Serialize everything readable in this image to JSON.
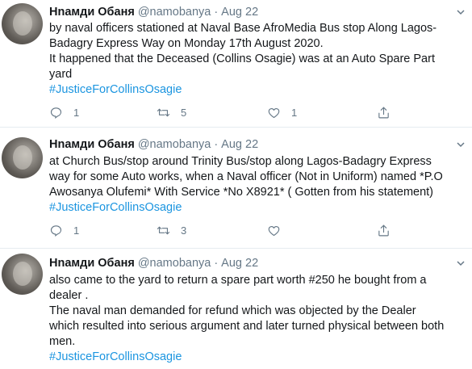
{
  "tweets": [
    {
      "author": "Нnамди Обаня",
      "handle": "@namobanya",
      "time": "Aug 22",
      "lines": [
        "by naval officers stationed at Naval Base AfroMedia Bus stop Along Lagos-",
        "Badagry Express Way on Monday 17th August 2020.",
        "It happened that the Deceased (Collins Osagie) was at an Auto Spare Part",
        "yard"
      ],
      "hashtag": "#JusticeForCollinsOsagie",
      "replies": "1",
      "retweets": "5",
      "likes": "1"
    },
    {
      "author": "Нnамди Обаня",
      "handle": "@namobanya",
      "time": "Aug 22",
      "lines": [
        "at Church Bus/stop around Trinity Bus/stop along Lagos-Badagry Express",
        "way for some Auto works, when a Naval officer (Not in Uniform) named *P.O",
        "Awosanya Olufemi*  With Service *No X8921* ( Gotten from his statement)"
      ],
      "hashtag": "#JusticeForCollinsOsagie",
      "replies": "1",
      "retweets": "3",
      "likes": ""
    },
    {
      "author": "Нnамди Обаня",
      "handle": "@namobanya",
      "time": "Aug 22",
      "lines": [
        "also came to the yard to return a spare part worth #250 he bought from a",
        "dealer .",
        "The naval man demanded for refund which was objected by the Dealer",
        "which resulted into serious argument and later turned physical between both",
        "men."
      ],
      "hashtag": "#JusticeForCollinsOsagie",
      "replies": "",
      "retweets": "",
      "likes": ""
    }
  ],
  "icons": {
    "reply": "reply-icon",
    "retweet": "retweet-icon",
    "like": "heart-icon",
    "share": "share-icon",
    "more": "chevron-down-icon"
  },
  "colors": {
    "link": "#1b95e0",
    "secondary": "#657786",
    "text": "#14171a",
    "divider": "#e6ecf0"
  }
}
